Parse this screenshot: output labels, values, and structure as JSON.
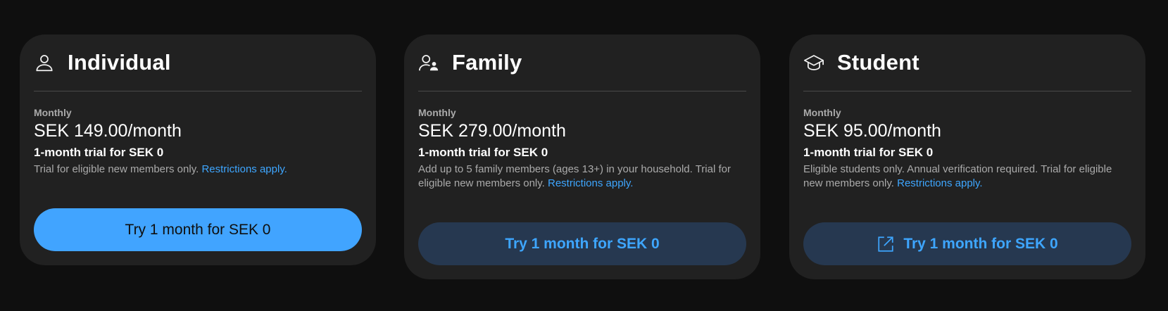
{
  "plans": [
    {
      "icon": "person-icon",
      "title": "Individual",
      "period": "Monthly",
      "price": "SEK 149.00/month",
      "trial": "1-month trial for SEK 0",
      "description": "Trial for eligible new members only.",
      "link": "Restrictions apply.",
      "button": "Try 1 month for SEK 0"
    },
    {
      "icon": "family-icon",
      "title": "Family",
      "period": "Monthly",
      "price": "SEK 279.00/month",
      "trial": "1-month trial for SEK 0",
      "description": "Add up to 5 family members (ages 13+) in your household. Trial for eligible new members only.",
      "link": "Restrictions apply.",
      "button": "Try 1 month for SEK 0"
    },
    {
      "icon": "graduation-cap-icon",
      "title": "Student",
      "period": "Monthly",
      "price": "SEK 95.00/month",
      "trial": "1-month trial for SEK 0",
      "description": "Eligible students only. Annual verification required. Trial for eligible new members only.",
      "link": "Restrictions apply.",
      "button": "Try 1 month for SEK 0",
      "button_icon": "external-link-icon"
    }
  ],
  "colors": {
    "background": "#0f0f0f",
    "card": "#212121",
    "accent": "#3ea6ff",
    "primary_button": "#41a4ff",
    "secondary_button": "#263850"
  }
}
